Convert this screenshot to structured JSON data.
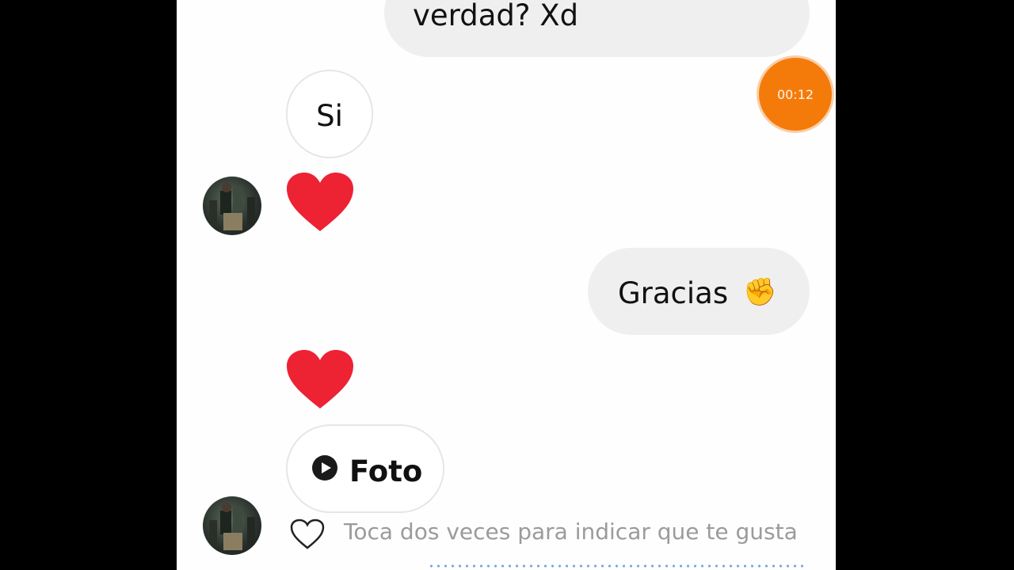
{
  "messages": {
    "out_1": {
      "text": "verdad? Xd"
    },
    "in_1": {
      "text": "Si"
    },
    "out_2": {
      "text": "Gracias",
      "emoji": "✊"
    },
    "in_photo": {
      "label": "Foto",
      "icon": "play-circle-icon"
    }
  },
  "recording": {
    "time": "00:12",
    "color": "#f47b0a"
  },
  "footer": {
    "hint": "Toca dos veces para indicar que te gusta",
    "icon": "heart-outline-icon"
  },
  "colors": {
    "heart": "#ed2233",
    "outgoing_bubble": "#efefef",
    "background": "#fefefe"
  }
}
